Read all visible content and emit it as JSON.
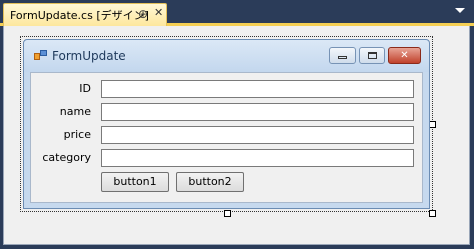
{
  "tab": {
    "title": "FormUpdate.cs [デザイン]",
    "pin_glyph": "⊕",
    "close_glyph": "✕"
  },
  "form": {
    "title": "FormUpdate",
    "fields": [
      {
        "label": "ID",
        "value": ""
      },
      {
        "label": "name",
        "value": ""
      },
      {
        "label": "price",
        "value": ""
      },
      {
        "label": "category",
        "value": ""
      }
    ],
    "buttons": {
      "button1": "button1",
      "button2": "button2"
    },
    "close_glyph": "✕"
  },
  "colors": {
    "ide_background": "#2b3c59",
    "tab_accent": "#f5cf53",
    "designer_background": "#f0f0f0"
  }
}
